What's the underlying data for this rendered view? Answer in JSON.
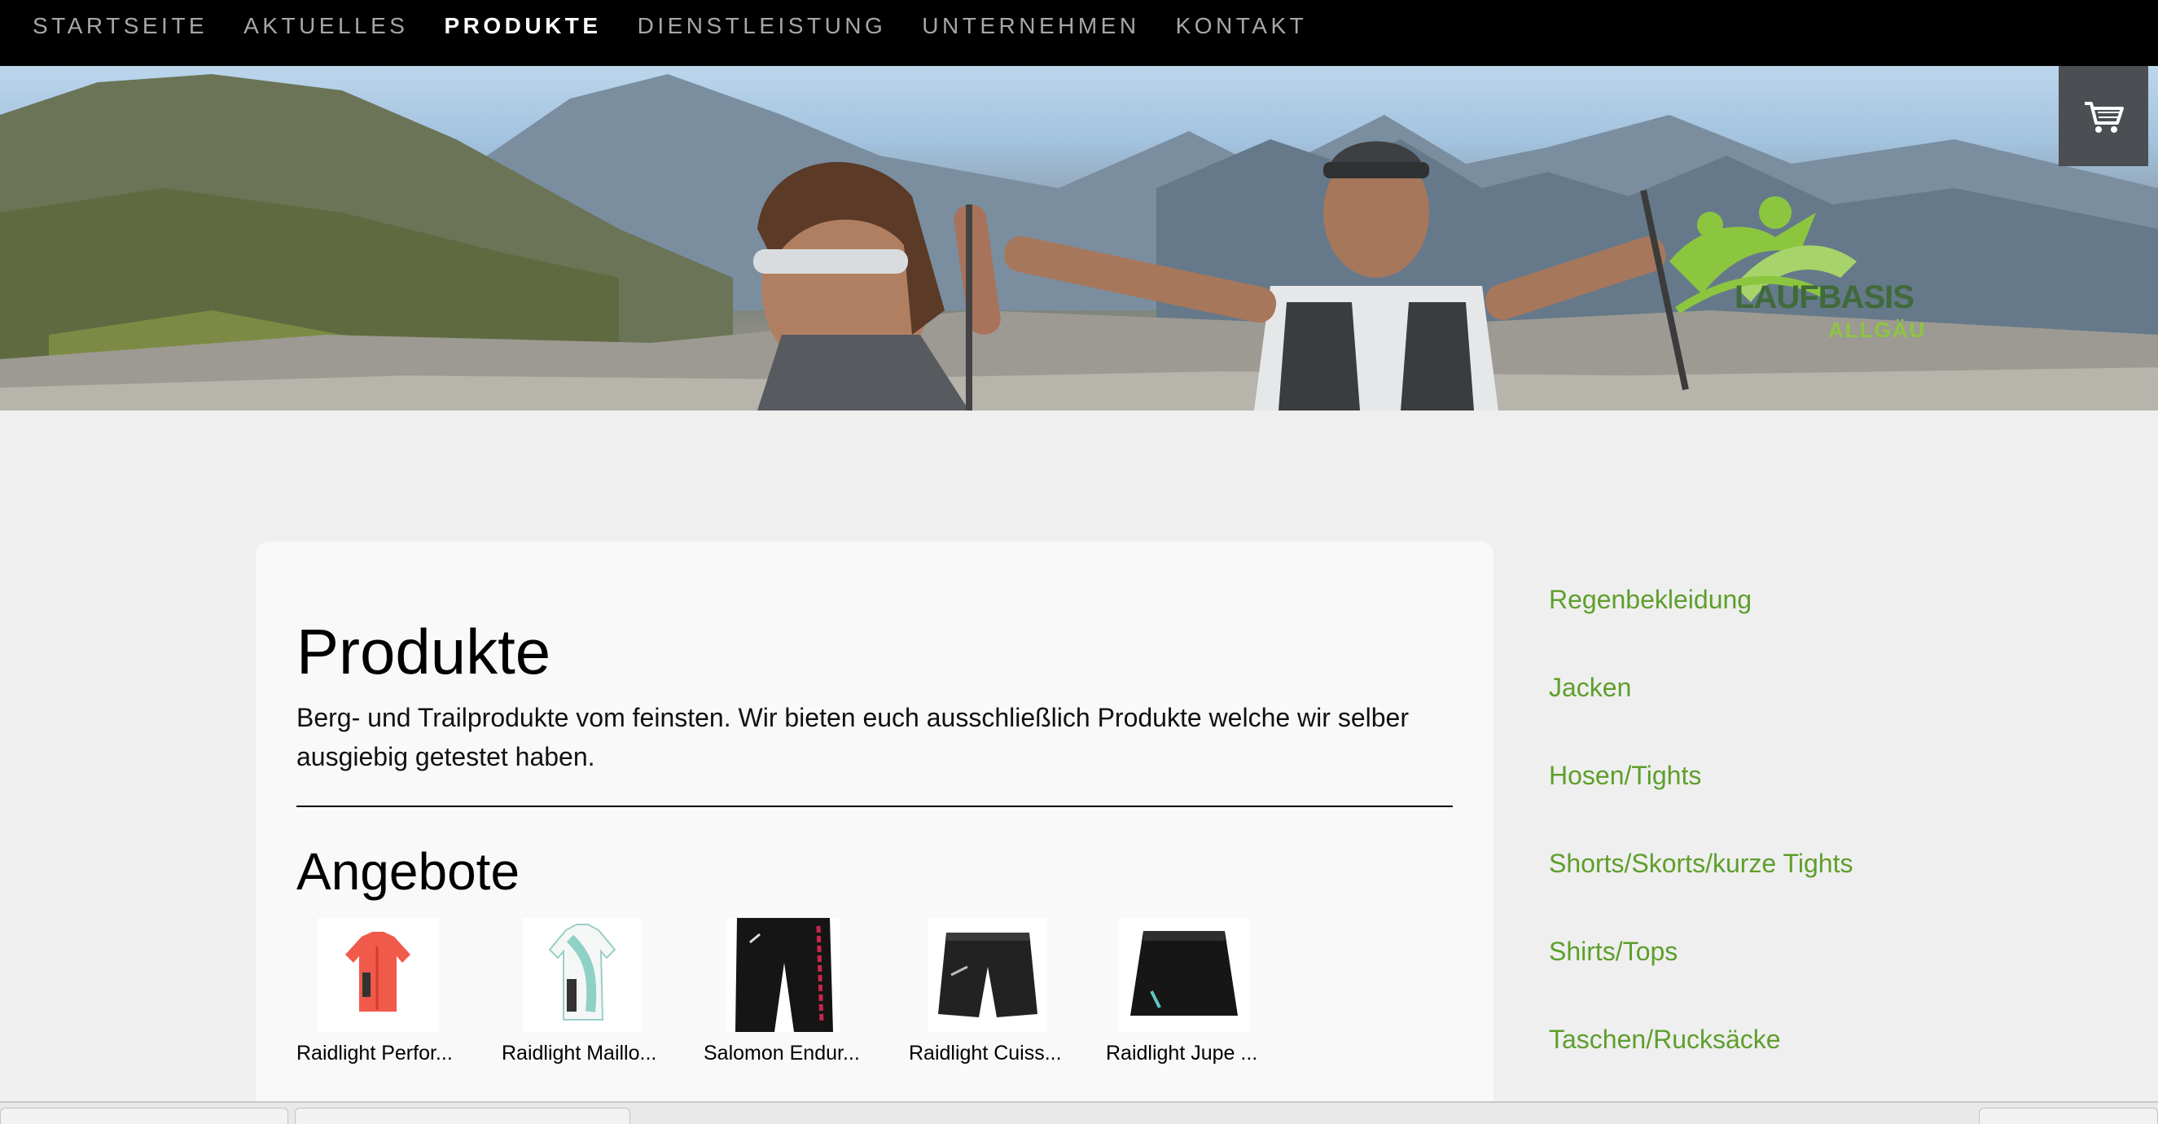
{
  "nav": {
    "items": [
      {
        "label": "STARTSEITE",
        "active": false
      },
      {
        "label": "AKTUELLES",
        "active": false
      },
      {
        "label": "PRODUKTE",
        "active": true
      },
      {
        "label": "DIENSTLEISTUNG",
        "active": false
      },
      {
        "label": "UNTERNEHMEN",
        "active": false
      },
      {
        "label": "KONTAKT",
        "active": false
      }
    ]
  },
  "hero": {
    "logo_line1": "LAUFBASIS",
    "logo_line2": "ALLGÄU",
    "cart_icon": "shopping-cart-icon"
  },
  "main": {
    "title": "Produkte",
    "intro": "Berg- und Trailprodukte vom feinsten. Wir bieten euch ausschließlich Produkte welche wir selber ausgiebig getestet haben.",
    "offers_title": "Angebote",
    "products": [
      {
        "name": "Raidlight Perfor...",
        "icon": "red-shirt-icon"
      },
      {
        "name": "Raidlight Maillo...",
        "icon": "white-shirt-icon"
      },
      {
        "name": "Salomon Endur...",
        "icon": "black-tights-icon"
      },
      {
        "name": "Raidlight Cuiss...",
        "icon": "black-shorts-icon"
      },
      {
        "name": "Raidlight Jupe ...",
        "icon": "black-skirt-icon"
      }
    ]
  },
  "sidebar": {
    "items": [
      "Regenbekleidung",
      "Jacken",
      "Hosen/Tights",
      "Shorts/Skorts/kurze Tights",
      "Shirts/Tops",
      "Taschen/Rucksäcke"
    ]
  },
  "colors": {
    "nav_bg": "#000000",
    "nav_active": "#ffffff",
    "nav_inactive": "#a7a7a7",
    "sidebar_link": "#5e9f2b",
    "logo_green": "#8cc63f",
    "cart_bg": "#4b4e52"
  }
}
